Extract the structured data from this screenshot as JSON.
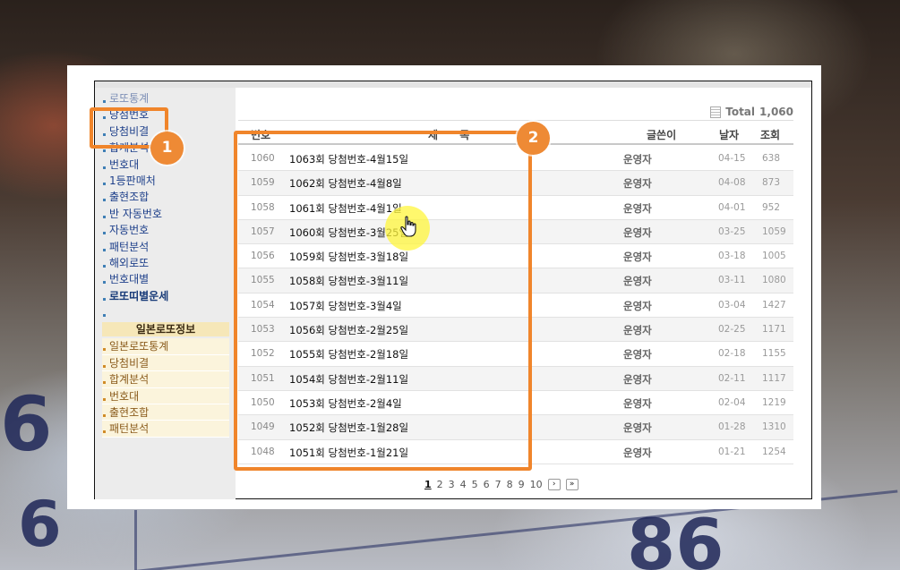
{
  "sidebar": {
    "items": [
      {
        "label": "로또통계",
        "faded": true
      },
      {
        "label": "당첨번호",
        "bold": false
      },
      {
        "label": "당첨비결",
        "faded": false
      },
      {
        "label": "합계분석"
      },
      {
        "label": "번호대"
      },
      {
        "label": "1등판매처"
      },
      {
        "label": "출현조합"
      },
      {
        "label": "반 자동번호"
      },
      {
        "label": "자동번호"
      },
      {
        "label": "패턴분석"
      },
      {
        "label": "해외로또"
      },
      {
        "label": "번호대별"
      },
      {
        "label": "로또띠별운세",
        "bold": true
      }
    ],
    "japan_header": "일본로또정보",
    "japan_items": [
      "일본로또통계",
      "당첨비결",
      "합계분석",
      "번호대",
      "출현조합",
      "패턴분석"
    ]
  },
  "board": {
    "total_label": "Total",
    "total_count": "1,060",
    "headers": {
      "no": "번호",
      "title": "제 목",
      "author": "글쓴이",
      "date": "날자",
      "views": "조회"
    },
    "rows": [
      {
        "no": "1060",
        "title": "1063회 당첨번호-4월15일",
        "author": "운영자",
        "date": "04-15",
        "views": "638"
      },
      {
        "no": "1059",
        "title": "1062회 당첨번호-4월8일",
        "author": "운영자",
        "date": "04-08",
        "views": "873"
      },
      {
        "no": "1058",
        "title": "1061회 당첨번호-4월1일",
        "author": "운영자",
        "date": "04-01",
        "views": "952"
      },
      {
        "no": "1057",
        "title": "1060회 당첨번호-3월25일",
        "author": "운영자",
        "date": "03-25",
        "views": "1059"
      },
      {
        "no": "1056",
        "title": "1059회 당첨번호-3월18일",
        "author": "운영자",
        "date": "03-18",
        "views": "1005"
      },
      {
        "no": "1055",
        "title": "1058회 당첨번호-3월11일",
        "author": "운영자",
        "date": "03-11",
        "views": "1080"
      },
      {
        "no": "1054",
        "title": "1057회 당첨번호-3월4일",
        "author": "운영자",
        "date": "03-04",
        "views": "1427"
      },
      {
        "no": "1053",
        "title": "1056회 당첨번호-2월25일",
        "author": "운영자",
        "date": "02-25",
        "views": "1171"
      },
      {
        "no": "1052",
        "title": "1055회 당첨번호-2월18일",
        "author": "운영자",
        "date": "02-18",
        "views": "1155"
      },
      {
        "no": "1051",
        "title": "1054회 당첨번호-2월11일",
        "author": "운영자",
        "date": "02-11",
        "views": "1117"
      },
      {
        "no": "1050",
        "title": "1053회 당첨번호-2월4일",
        "author": "운영자",
        "date": "02-04",
        "views": "1219"
      },
      {
        "no": "1049",
        "title": "1052회 당첨번호-1월28일",
        "author": "운영자",
        "date": "01-28",
        "views": "1310"
      },
      {
        "no": "1048",
        "title": "1051회 당첨번호-1월21일",
        "author": "운영자",
        "date": "01-21",
        "views": "1254"
      }
    ],
    "pagination": {
      "pages": [
        "1",
        "2",
        "3",
        "4",
        "5",
        "6",
        "7",
        "8",
        "9",
        "10"
      ],
      "current": "1",
      "next_icon": "chevron-right-icon",
      "last_icon": "double-chevron-right-icon"
    }
  },
  "annotations": {
    "badge_1": "1",
    "badge_2": "2",
    "accent_color": "#ee8a35"
  },
  "background": {
    "numbers": [
      "6",
      "6",
      "86"
    ]
  }
}
